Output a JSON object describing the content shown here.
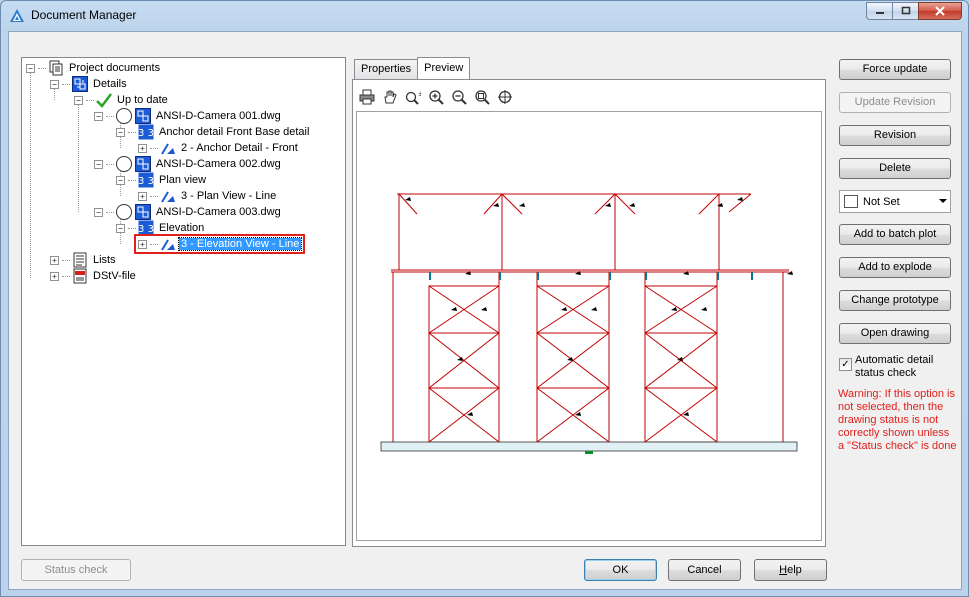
{
  "window": {
    "title": "Document Manager"
  },
  "tree": {
    "root": "Project documents",
    "details": "Details",
    "up_to_date": "Up to date",
    "dwg1": "ANSI-D-Camera 001.dwg",
    "dwg1_view": "Anchor detail Front Base detail",
    "dwg1_item": "2 - Anchor Detail - Front",
    "dwg2": "ANSI-D-Camera 002.dwg",
    "dwg2_view": "Plan view",
    "dwg2_item": "3 - Plan View - Line",
    "dwg3": "ANSI-D-Camera 003.dwg",
    "dwg3_view": "Elevation",
    "dwg3_item": "3 - Elevation View - Line",
    "lists": "Lists",
    "dstv": "DStV-file"
  },
  "tabs": [
    {
      "label": "Properties"
    },
    {
      "label": "Preview"
    }
  ],
  "side_buttons": {
    "force_update": "Force update",
    "update_revision": "Update Revision",
    "revision": "Revision",
    "delete": "Delete",
    "not_set": "Not Set",
    "add_batch": "Add to batch plot",
    "add_explode": "Add to explode",
    "change_prototype": "Change prototype",
    "open_drawing": "Open drawing"
  },
  "auto_check": {
    "label_line1": "Automatic detail",
    "label_line2": "status check",
    "checked": "✓"
  },
  "warning": "Warning: If this option is not selected, then the drawing status is not correctly shown unless a \"Status check\" is done",
  "bottom": {
    "status_check": "Status check",
    "ok": "OK",
    "cancel": "Cancel",
    "help_h": "H",
    "help_rest": "elp"
  },
  "colors": {
    "accent_red": "#e0201c",
    "frame_red": "#c00000",
    "selection": "#3399ff"
  }
}
